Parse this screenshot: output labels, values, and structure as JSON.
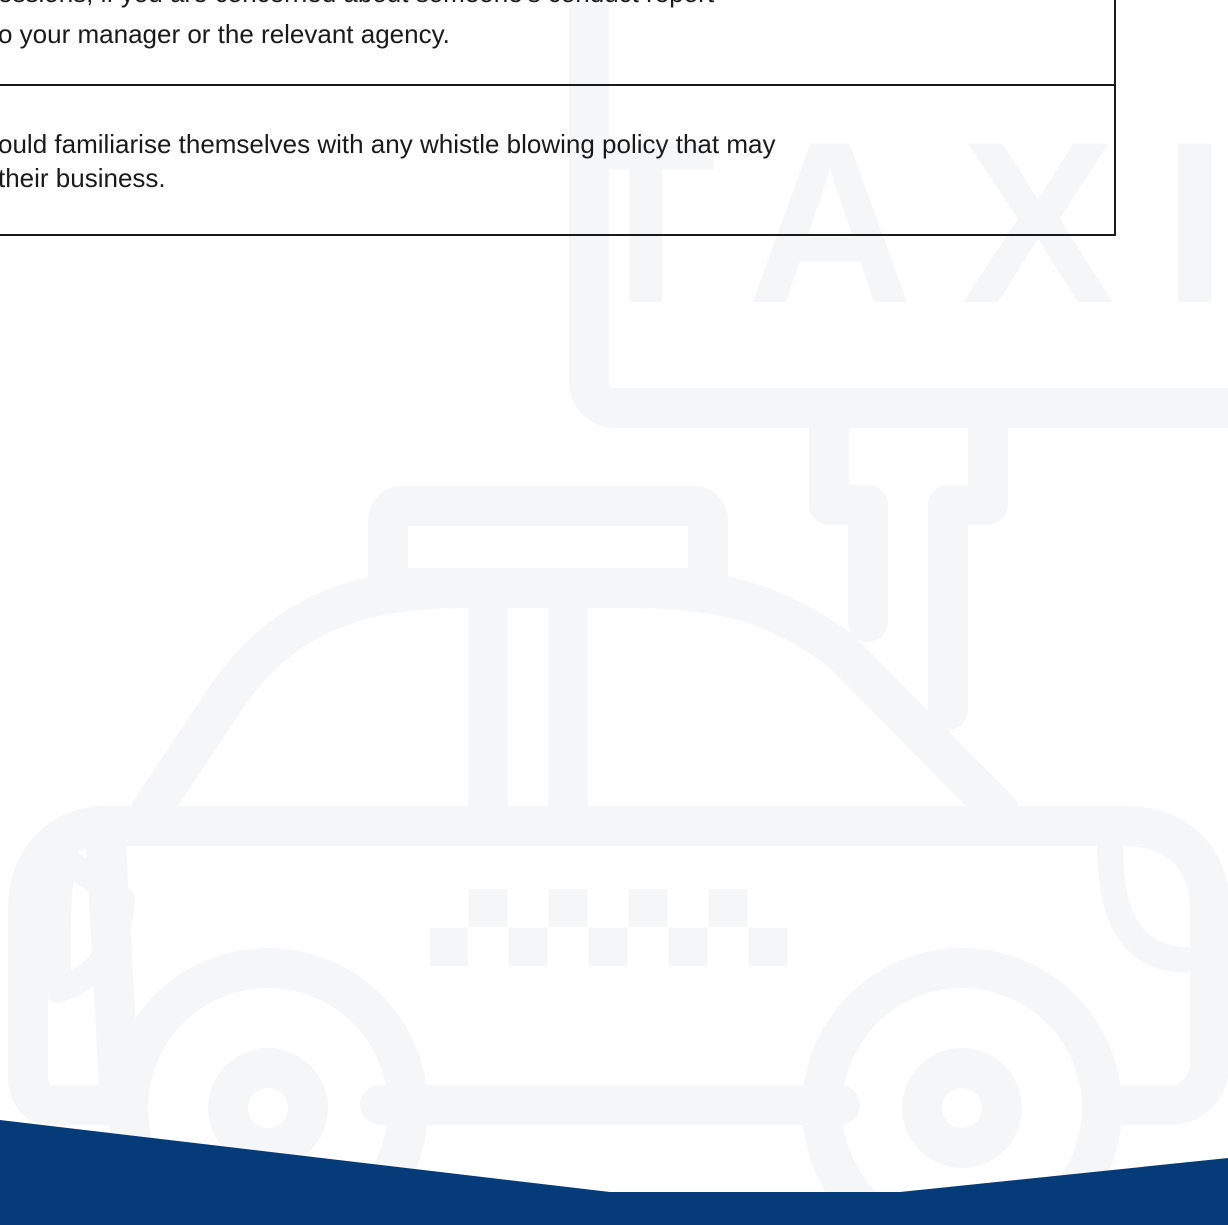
{
  "content": {
    "rows": [
      {
        "line_a": "essions, if you are concerned about someone's conduct report",
        "line_b": "o your manager or the relevant agency."
      },
      {
        "line_a": "ould familiarise themselves with any whistle blowing policy that may",
        "line_b": "their business."
      }
    ]
  },
  "illustration": {
    "icon": "taxi-with-sign-icon",
    "sign_text": "TAXI",
    "line_color": "#f5f6f8"
  },
  "footer": {
    "band_color": "#063b7a"
  }
}
